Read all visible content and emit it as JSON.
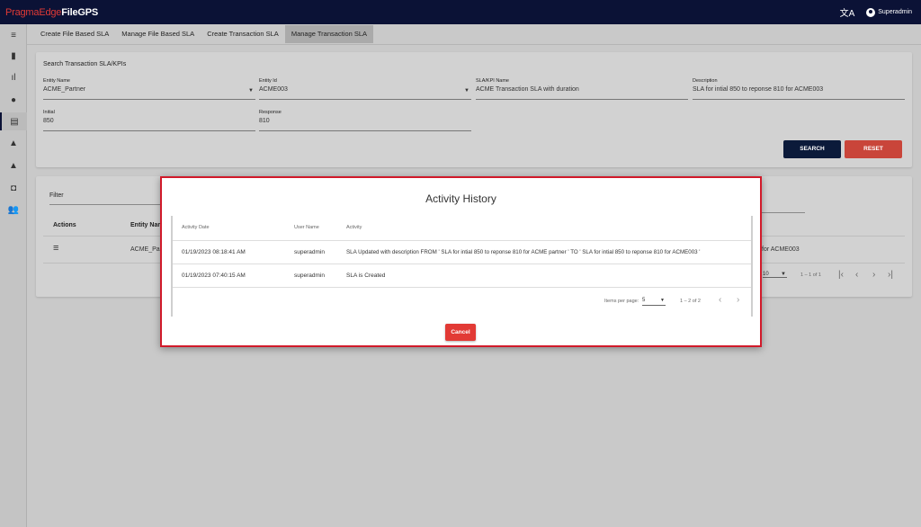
{
  "app": {
    "logo_part1": "PragmaEdge",
    "logo_part2": "FileGPS",
    "user": "Superadmin"
  },
  "tabs": [
    "Create File Based SLA",
    "Manage File Based SLA",
    "Create Transaction SLA",
    "Manage Transaction SLA"
  ],
  "search": {
    "title": "Search Transaction SLA/KPIs",
    "entity_name": {
      "label": "Entity Name",
      "value": "ACME_Partner"
    },
    "entity_id": {
      "label": "Entity Id",
      "value": "ACME003"
    },
    "sla_name": {
      "label": "SLA/KPI Name",
      "value": "ACME Transaction SLA with duration"
    },
    "description": {
      "label": "Description",
      "value": "SLA for intial 850 to reponse 810 for ACME003"
    },
    "initial": {
      "label": "Initial",
      "value": "850"
    },
    "response": {
      "label": "Response",
      "value": "810"
    },
    "search_button": "SEARCH",
    "reset_button": "RESET"
  },
  "results": {
    "filter_label": "Filter",
    "col_actions": "Actions",
    "col_entity_name": "Entity Nam",
    "row_entity": "ACME_Par",
    "row_description_tail": "for ACME003",
    "page_size": "10",
    "range": "1 – 1 of 1"
  },
  "modal": {
    "title": "Activity History",
    "columns": [
      "Activity Date",
      "User Name",
      "Activity"
    ],
    "rows": [
      {
        "date": "01/19/2023 08:18:41 AM",
        "user": "superadmin",
        "activity": "SLA Updated with description FROM ' SLA for intial 850 to reponse 810 for ACME partner ' TO ' SLA for intial 850 to reponse 810 for ACME003 '"
      },
      {
        "date": "01/19/2023 07:40:15 AM",
        "user": "superadmin",
        "activity": "SLA is Created"
      }
    ],
    "items_per_page_label": "Items per page:",
    "items_per_page": "5",
    "range": "1 – 2 of 2",
    "cancel_button": "Cancel"
  },
  "colors": {
    "accent_red": "#e23a35",
    "nav_dark": "#0b1236",
    "modal_border": "#d11a2a"
  }
}
